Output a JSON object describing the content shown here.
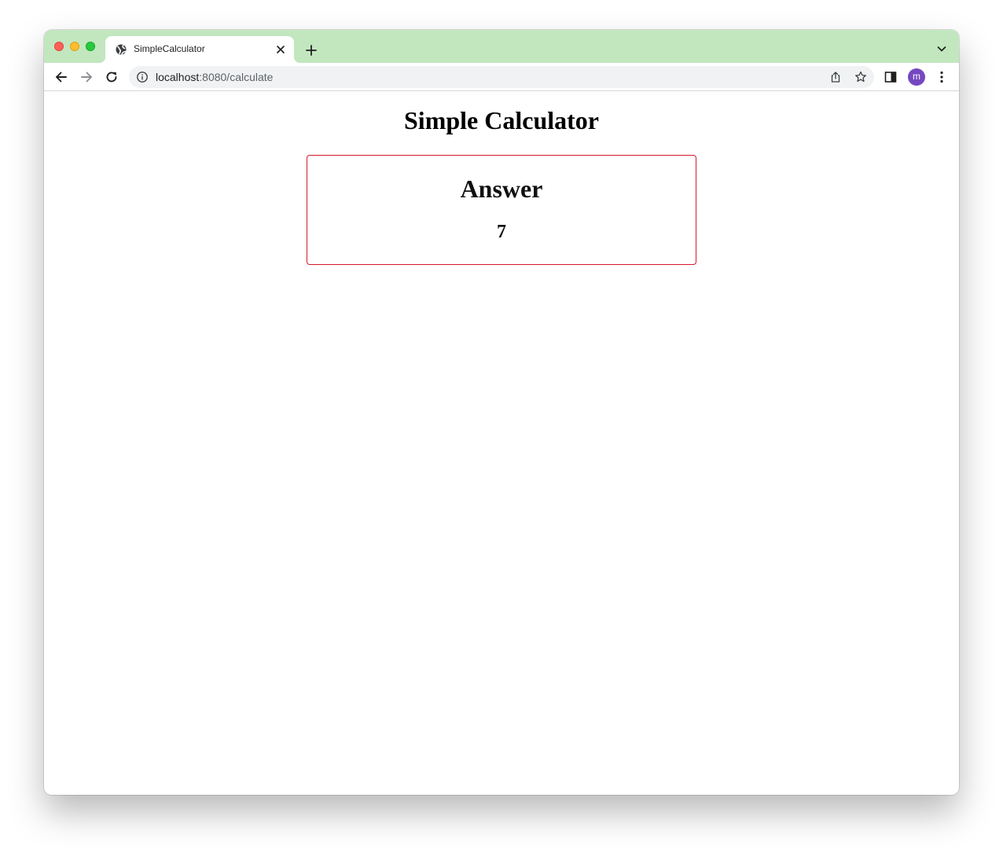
{
  "browser": {
    "tab": {
      "title": "SimpleCalculator",
      "favicon": "globe-icon"
    },
    "address_bar": {
      "host": "localhost",
      "path": ":8080/calculate"
    },
    "profile": {
      "initial": "m",
      "color": "#7548c1"
    },
    "titlebar_color": "#c2e7bf"
  },
  "page": {
    "title": "Simple Calculator",
    "answer": {
      "heading": "Answer",
      "value": "7",
      "border_color": "#d31a2c"
    }
  }
}
